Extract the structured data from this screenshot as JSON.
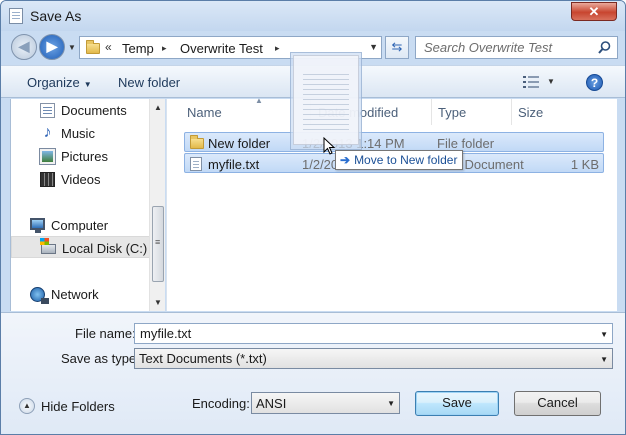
{
  "window": {
    "title": "Save As",
    "close_label": "✕"
  },
  "address": {
    "prefix": "«",
    "crumbs": [
      "Temp",
      "Overwrite Test"
    ],
    "separator": "▸"
  },
  "search": {
    "placeholder": "Search Overwrite Test"
  },
  "toolbar": {
    "organize_label": "Organize",
    "new_folder_label": "New folder"
  },
  "nav": {
    "favorites": [
      {
        "label": "Documents",
        "icon": "documents-icon"
      },
      {
        "label": "Music",
        "icon": "music-icon"
      },
      {
        "label": "Pictures",
        "icon": "pictures-icon"
      },
      {
        "label": "Videos",
        "icon": "videos-icon"
      }
    ],
    "computer": {
      "label": "Computer",
      "icon": "computer-icon"
    },
    "local_disk": {
      "label": "Local Disk (C:)",
      "icon": "disk-icon"
    },
    "network": {
      "label": "Network",
      "icon": "network-icon"
    }
  },
  "columns": {
    "name": "Name",
    "date": "Date modified",
    "type": "Type",
    "size": "Size"
  },
  "files": [
    {
      "name": "New folder",
      "date": "1/2/2013 1:14 PM",
      "type": "File folder",
      "size": "",
      "icon": "folder-icon"
    },
    {
      "name": "myfile.txt",
      "date": "1/2/2013 1:14 PM",
      "type": "Text Document",
      "size": "1 KB",
      "icon": "text-file-icon"
    }
  ],
  "drag": {
    "tooltip": "Move to New folder"
  },
  "form": {
    "filename_label": "File name:",
    "filename_value": "myfile.txt",
    "savetype_label": "Save as type:",
    "savetype_value": "Text Documents (*.txt)",
    "hide_folders_label": "Hide Folders",
    "encoding_label": "Encoding:",
    "encoding_value": "ANSI",
    "save_label": "Save",
    "cancel_label": "Cancel"
  },
  "colors": {
    "accent": "#2d64b3",
    "selection": "#c1d9f6",
    "close": "#c8452f"
  }
}
